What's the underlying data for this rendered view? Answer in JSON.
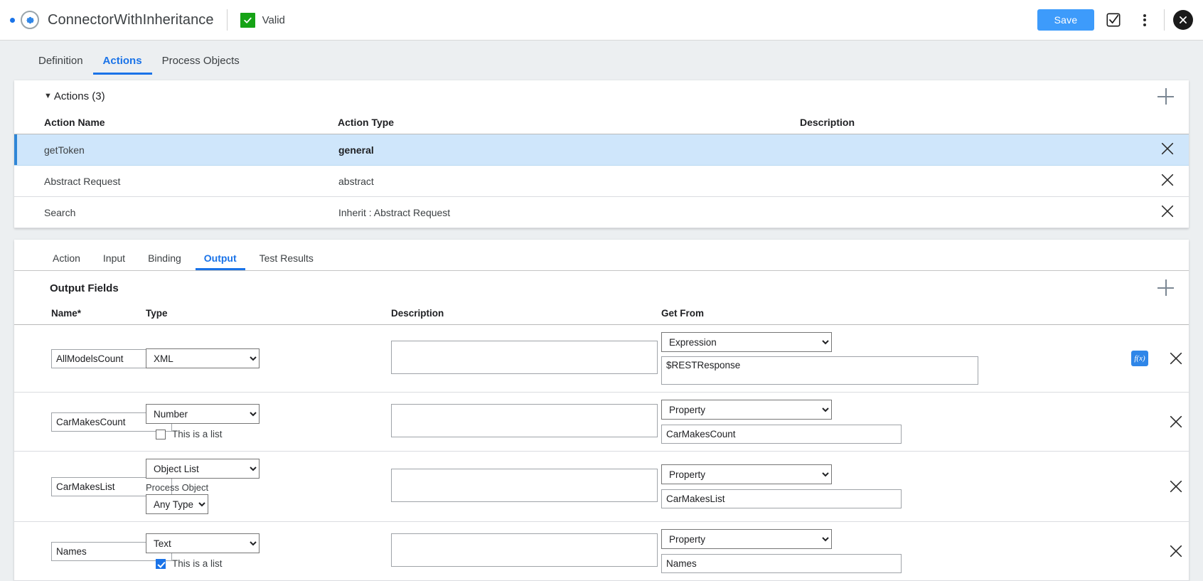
{
  "titlebar": {
    "icon": "gear-icon",
    "title": "ConnectorWithInheritance",
    "status_icon": "check-icon",
    "status_label": "Valid",
    "save_label": "Save",
    "validate_icon": "checkbox-check-icon",
    "menu_icon": "more-vertical-icon",
    "close_icon": "close-circle-icon",
    "accent_color": "#3d9bfb",
    "valid_color": "#16a316"
  },
  "main_tabs": [
    {
      "label": "Definition",
      "active": false
    },
    {
      "label": "Actions",
      "active": true
    },
    {
      "label": "Process Objects",
      "active": false
    }
  ],
  "actions_panel": {
    "caret": "▼",
    "title": "Actions (3)",
    "add_icon": "plus-icon",
    "columns": [
      "Action Name",
      "Action Type",
      "Description"
    ],
    "rows": [
      {
        "name": "getToken",
        "type": "general",
        "description": "",
        "selected": true
      },
      {
        "name": "Abstract Request",
        "type": "abstract",
        "description": "",
        "selected": false
      },
      {
        "name": "Search",
        "type": "Inherit : Abstract Request",
        "description": "",
        "selected": false
      }
    ],
    "delete_icon": "close-icon"
  },
  "sub_tabs": [
    {
      "label": "Action",
      "active": false
    },
    {
      "label": "Input",
      "active": false
    },
    {
      "label": "Binding",
      "active": false
    },
    {
      "label": "Output",
      "active": true
    },
    {
      "label": "Test Results",
      "active": false
    }
  ],
  "output_fields": {
    "title": "Output Fields",
    "add_icon": "plus-icon",
    "columns": [
      "Name*",
      "Type",
      "Description",
      "Get From"
    ],
    "list_checkbox_label": "This is a list",
    "process_object_label": "Process Object",
    "fx_label": "f(x)",
    "rows": [
      {
        "name": "AllModelsCount",
        "type": "XML",
        "show_list_checkbox": false,
        "is_list": false,
        "show_process_object": false,
        "process_object": "",
        "description": "",
        "get_from": "Expression",
        "get_value": "$RESTResponse",
        "has_fx": true
      },
      {
        "name": "CarMakesCount",
        "type": "Number",
        "show_list_checkbox": true,
        "is_list": false,
        "show_process_object": false,
        "process_object": "",
        "description": "",
        "get_from": "Property",
        "get_value": "CarMakesCount",
        "has_fx": false
      },
      {
        "name": "CarMakesList",
        "type": "Object List",
        "show_list_checkbox": false,
        "is_list": false,
        "show_process_object": true,
        "process_object": "Any Type",
        "description": "",
        "get_from": "Property",
        "get_value": "CarMakesList",
        "has_fx": false
      },
      {
        "name": "Names",
        "type": "Text",
        "show_list_checkbox": true,
        "is_list": true,
        "show_process_object": false,
        "process_object": "",
        "description": "",
        "get_from": "Property",
        "get_value": "Names",
        "has_fx": false
      }
    ],
    "delete_icon": "close-icon"
  }
}
